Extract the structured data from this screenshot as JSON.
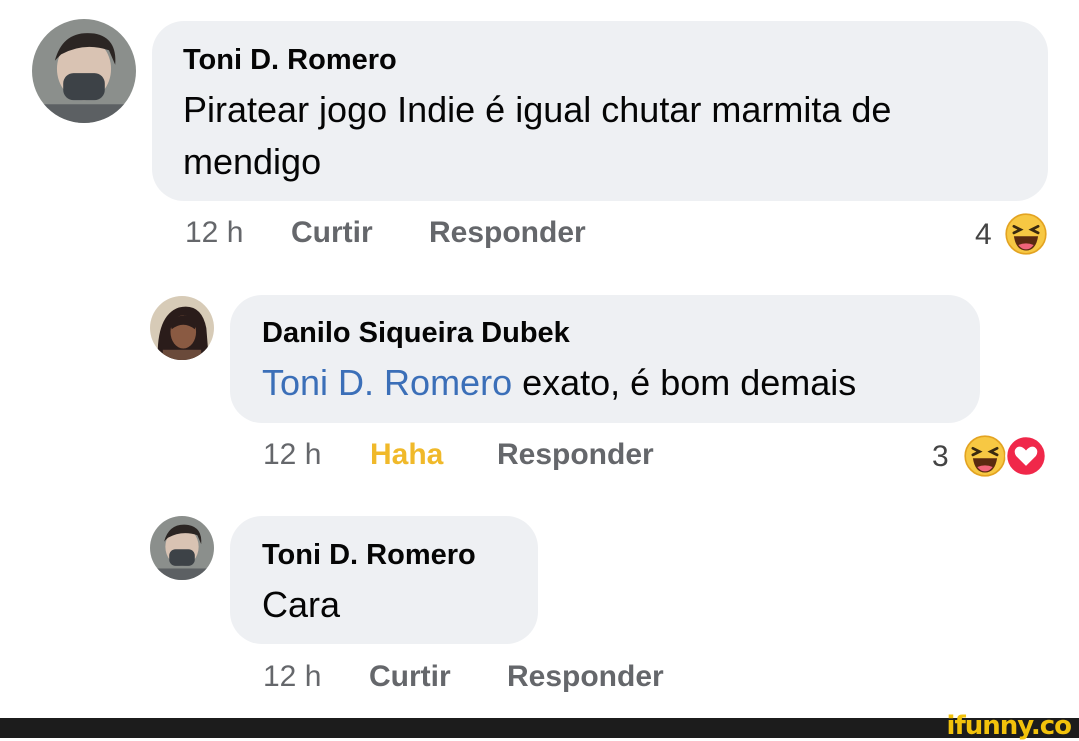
{
  "comments": [
    {
      "author": "Toni D. Romero",
      "text": "Piratear jogo Indie é igual chutar marmita de mendigo",
      "time": "12 h",
      "like_label": "Curtir",
      "reply_label": "Responder",
      "reaction_count": "4",
      "reactions": [
        "haha-emoji-icon"
      ]
    },
    {
      "author": "Danilo Siqueira Dubek",
      "mention": "Toni D. Romero",
      "text": " exato, é bom demais",
      "time": "12 h",
      "like_label": "Haha",
      "reply_label": "Responder",
      "reaction_count": "3",
      "reactions": [
        "haha-emoji-icon",
        "love-heart-icon"
      ]
    },
    {
      "author": "Toni D. Romero",
      "text": "Cara",
      "time": "12 h",
      "like_label": "Curtir",
      "reply_label": "Responder"
    }
  ],
  "watermark": "ifunny.co",
  "colors": {
    "bubble": "#eef0f3",
    "mention": "#3b6fb8",
    "haha": "#f0b92a",
    "meta": "#65676b",
    "love": "#f0284a"
  }
}
